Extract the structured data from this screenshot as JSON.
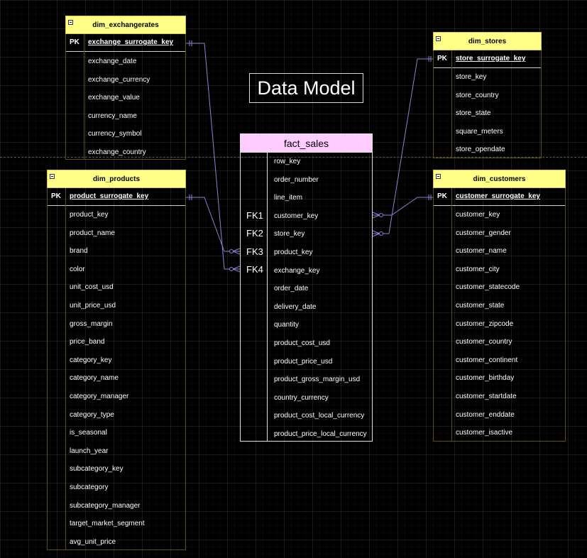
{
  "title": "Data Model",
  "entities": {
    "exchangerates": {
      "name": "dim_exchangerates",
      "pk_label": "PK",
      "pk": "exchange_surrogate_key",
      "fields": [
        "exchange_date",
        "exchange_currency",
        "exchange_value",
        "currency_name",
        "currency_symbol",
        "exchange_country"
      ]
    },
    "stores": {
      "name": "dim_stores",
      "pk_label": "PK",
      "pk": "store_surrogate_key",
      "fields": [
        "store_key",
        "store_country",
        "store_state",
        "square_meters",
        "store_opendate"
      ]
    },
    "products": {
      "name": "dim_products",
      "pk_label": "PK",
      "pk": "product_surrogate_key",
      "fields": [
        "product_key",
        "product_name",
        "brand",
        "color",
        "unit_cost_usd",
        "unit_price_usd",
        "gross_margin",
        "price_band",
        "category_key",
        "category_name",
        "category_manager",
        "category_type",
        "is_seasonal",
        "launch_year",
        "subcategory_key",
        "subcategory",
        "subcategory_manager",
        "target_market_segment",
        "avg_unit_price"
      ]
    },
    "customers": {
      "name": "dim_customers",
      "pk_label": "PK",
      "pk": "customer_surrogate_key",
      "fields": [
        "customer_key",
        "customer_gender",
        "customer_name",
        "customer_city",
        "customer_statecode",
        "customer_state",
        "customer_zipcode",
        "customer_country",
        "customer_continent",
        "customer_birthday",
        "customer_startdate",
        "customer_enddate",
        "customer_isactive"
      ]
    },
    "fact_sales": {
      "name": "fact_sales",
      "fk_labels": [
        "FK1",
        "FK2",
        "FK3",
        "FK4"
      ],
      "fields": [
        "row_key",
        "order_number",
        "line_item",
        "customer_key",
        "store_key",
        "product_key",
        "exchange_key",
        "order_date",
        "delivery_date",
        "quantity",
        "product_cost_usd",
        "product_price_usd",
        "product_gross_margin_usd",
        "country_currency",
        "product_cost_local_currency",
        "product_price_local_currency"
      ]
    }
  },
  "colors": {
    "entity_header": "#ffff88",
    "fact_header": "#ffccff",
    "relationship_line": "#8a84d6"
  }
}
